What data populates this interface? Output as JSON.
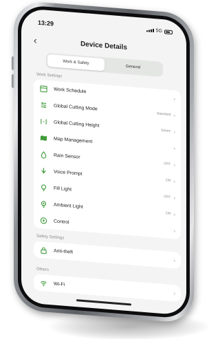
{
  "status_bar": {
    "time": "13:29",
    "network": "5G"
  },
  "header": {
    "title": "Device Details",
    "back_icon": "chevron-left-icon"
  },
  "tabs": [
    {
      "label": "Work & Safety",
      "active": true
    },
    {
      "label": "General",
      "active": false
    }
  ],
  "sections": {
    "work": {
      "header": "Work Settings",
      "items": [
        {
          "label": "Work Schedule",
          "value": "",
          "icon": "calendar-icon"
        },
        {
          "label": "Global Cutting Mode",
          "value": "Standard",
          "icon": "cutting-mode-icon"
        },
        {
          "label": "Global Cutting Height",
          "value": "50mm",
          "icon": "height-icon"
        },
        {
          "label": "Map Management",
          "value": "",
          "icon": "map-icon"
        },
        {
          "label": "Rain Sensor",
          "value": "OFF",
          "icon": "rain-icon"
        },
        {
          "label": "Voice Prompt",
          "value": "ON",
          "icon": "speaker-icon"
        },
        {
          "label": "Fill Light",
          "value": "OFF",
          "icon": "bulb-icon"
        },
        {
          "label": "Ambient Light",
          "value": "ON",
          "icon": "ambient-light-icon"
        },
        {
          "label": "Control",
          "value": "",
          "icon": "gamepad-icon"
        }
      ]
    },
    "safety": {
      "header": "Safety Settings",
      "items": [
        {
          "label": "Anti-theft",
          "value": "",
          "icon": "lock-icon"
        }
      ]
    },
    "others": {
      "header": "Others",
      "items": [
        {
          "label": "Wi-Fi",
          "value": "",
          "icon": "wifi-icon"
        }
      ]
    }
  },
  "colors": {
    "accent": "#3f9a3a",
    "screen_bg": "#f3f4f3"
  }
}
